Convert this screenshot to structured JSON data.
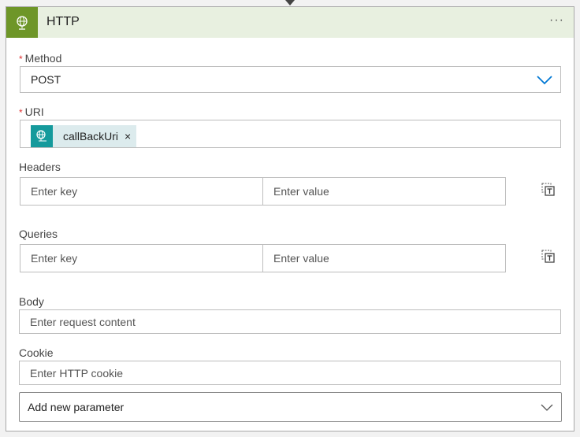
{
  "header": {
    "title": "HTTP",
    "more": "···"
  },
  "method": {
    "label": "Method",
    "required": "*",
    "value": "POST"
  },
  "uri": {
    "label": "URI",
    "required": "*",
    "token": "callBackUri",
    "remove": "×"
  },
  "headers": {
    "label": "Headers",
    "key_placeholder": "Enter key",
    "value_placeholder": "Enter value"
  },
  "queries": {
    "label": "Queries",
    "key_placeholder": "Enter key",
    "value_placeholder": "Enter value"
  },
  "body": {
    "label": "Body",
    "placeholder": "Enter request content"
  },
  "cookie": {
    "label": "Cookie",
    "placeholder": "Enter HTTP cookie"
  },
  "add_param": {
    "label": "Add new parameter"
  },
  "colors": {
    "accent": "#0078d4",
    "header_icon": "#6e9628",
    "token_icon": "#159a9c"
  }
}
